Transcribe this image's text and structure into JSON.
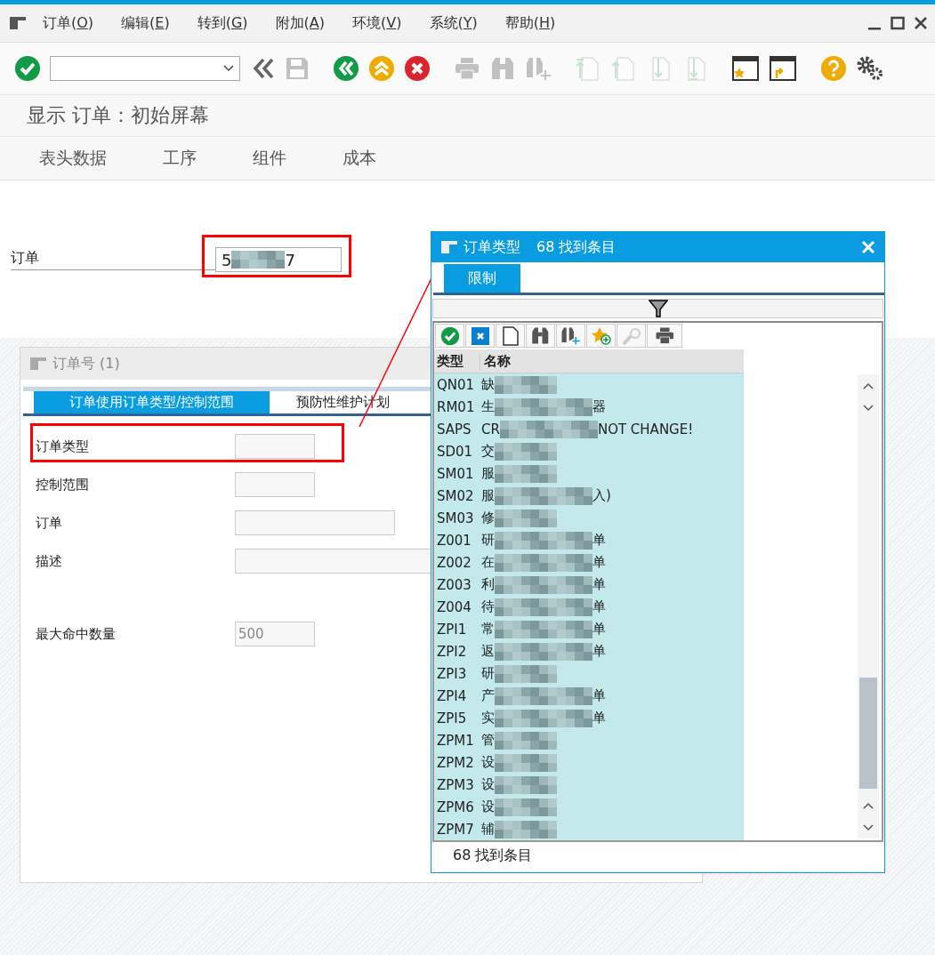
{
  "menu": [
    {
      "text": "订单(",
      "key": "O",
      "tail": ")"
    },
    {
      "text": "编辑(",
      "key": "E",
      "tail": ")"
    },
    {
      "text": "转到(",
      "key": "G",
      "tail": ")"
    },
    {
      "text": "附加(",
      "key": "A",
      "tail": ")"
    },
    {
      "text": "环境(",
      "key": "V",
      "tail": ")"
    },
    {
      "text": "系统(",
      "key": "Y",
      "tail": ")"
    },
    {
      "text": "帮助(",
      "key": "H",
      "tail": ")"
    }
  ],
  "toolbar": [
    {
      "kind": "enter",
      "disabled": false
    },
    {
      "kind": "command",
      "disabled": false
    },
    {
      "kind": "collapse",
      "disabled": false
    },
    {
      "kind": "save",
      "disabled": true
    },
    {
      "kind": "back",
      "disabled": false
    },
    {
      "kind": "exit",
      "disabled": false
    },
    {
      "kind": "cancel",
      "disabled": false
    },
    {
      "kind": "print",
      "disabled": true
    },
    {
      "kind": "find",
      "disabled": true
    },
    {
      "kind": "find-next",
      "disabled": true
    },
    {
      "kind": "first-page",
      "disabled": true
    },
    {
      "kind": "prev-page",
      "disabled": true
    },
    {
      "kind": "next-page",
      "disabled": true
    },
    {
      "kind": "last-page",
      "disabled": true
    },
    {
      "kind": "new-session",
      "disabled": false
    },
    {
      "kind": "shortcut",
      "disabled": false
    },
    {
      "kind": "help",
      "disabled": false
    },
    {
      "kind": "settings",
      "disabled": false
    }
  ],
  "screen_title": "显示 订单：初始屏幕",
  "app_tabs": [
    "表头数据",
    "工序",
    "组件",
    "成本"
  ],
  "order_field": {
    "label": "订单",
    "value_start": "5",
    "value_end": "7"
  },
  "subscreen": {
    "title": "订单号 (1)",
    "tabs": [
      {
        "label": "订单使用订单类型/控制范围",
        "selected": true
      },
      {
        "label": "预防性维护计划",
        "selected": false
      }
    ],
    "fields": [
      {
        "label": "订单类型"
      },
      {
        "label": "控制范围"
      },
      {
        "label": "订单"
      },
      {
        "label": "描述"
      },
      {
        "label": "最大命中数量",
        "value": "500"
      }
    ]
  },
  "popup": {
    "title": "订单类型",
    "count": "68 找到条目",
    "tabs": [
      {
        "label": "限制",
        "selected": true
      }
    ],
    "columns": [
      "类型",
      "名称"
    ],
    "rows": [
      {
        "type": "QN01",
        "name": "缺",
        "tail": ""
      },
      {
        "type": "RM01",
        "name": "生",
        "tail": "器"
      },
      {
        "type": "SAPS",
        "name": "CR",
        "tail": "NOT CHANGE!"
      },
      {
        "type": "SD01",
        "name": "交",
        "tail": ""
      },
      {
        "type": "SM01",
        "name": "服",
        "tail": ""
      },
      {
        "type": "SM02",
        "name": "服",
        "tail": "入)"
      },
      {
        "type": "SM03",
        "name": "修",
        "tail": ""
      },
      {
        "type": "Z001",
        "name": "研",
        "tail": "单"
      },
      {
        "type": "Z002",
        "name": "在",
        "tail": "单"
      },
      {
        "type": "Z003",
        "name": "利",
        "tail": "单"
      },
      {
        "type": "Z004",
        "name": "待",
        "tail": "单"
      },
      {
        "type": "ZPI1",
        "name": "常",
        "tail": "单"
      },
      {
        "type": "ZPI2",
        "name": "返",
        "tail": "单"
      },
      {
        "type": "ZPI3",
        "name": "研",
        "tail": ""
      },
      {
        "type": "ZPI4",
        "name": "产",
        "tail": "单"
      },
      {
        "type": "ZPI5",
        "name": "实",
        "tail": "单"
      },
      {
        "type": "ZPM1",
        "name": "管",
        "tail": ""
      },
      {
        "type": "ZPM2",
        "name": "设",
        "tail": ""
      },
      {
        "type": "ZPM3",
        "name": "设",
        "tail": ""
      },
      {
        "type": "ZPM6",
        "name": "设",
        "tail": ""
      },
      {
        "type": "ZPM7",
        "name": "辅",
        "tail": ""
      }
    ],
    "status": "68 找到条目"
  }
}
